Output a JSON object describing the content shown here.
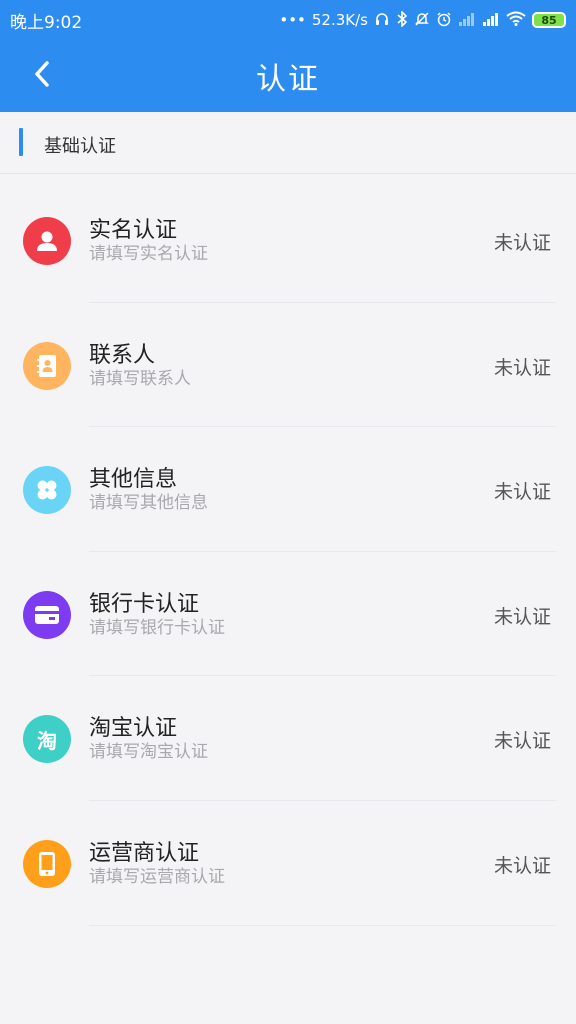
{
  "status_bar": {
    "time": "晚上9:02",
    "dots": "•••",
    "speed": "52.3K/s",
    "battery": "85"
  },
  "nav": {
    "title": "认证"
  },
  "section": {
    "label": "基础认证"
  },
  "colors": {
    "primary": "#2d8cf0",
    "icon_real_name": "#ef3e4a",
    "icon_contacts": "#ffb45f",
    "icon_other": "#69d4f6",
    "icon_bank": "#7d3cf0",
    "icon_taobao": "#3ecfc7",
    "icon_operator": "#ff9f1a"
  },
  "items": [
    {
      "title": "实名认证",
      "subtitle": "请填写实名认证",
      "status": "未认证",
      "icon": "user-icon"
    },
    {
      "title": "联系人",
      "subtitle": "请填写联系人",
      "status": "未认证",
      "icon": "contact-book-icon"
    },
    {
      "title": "其他信息",
      "subtitle": "请填写其他信息",
      "status": "未认证",
      "icon": "clover-icon"
    },
    {
      "title": "银行卡认证",
      "subtitle": "请填写银行卡认证",
      "status": "未认证",
      "icon": "bank-card-icon"
    },
    {
      "title": "淘宝认证",
      "subtitle": "请填写淘宝认证",
      "status": "未认证",
      "icon": "taobao-icon",
      "icon_char": "淘"
    },
    {
      "title": "运营商认证",
      "subtitle": "请填写运营商认证",
      "status": "未认证",
      "icon": "phone-icon"
    }
  ]
}
